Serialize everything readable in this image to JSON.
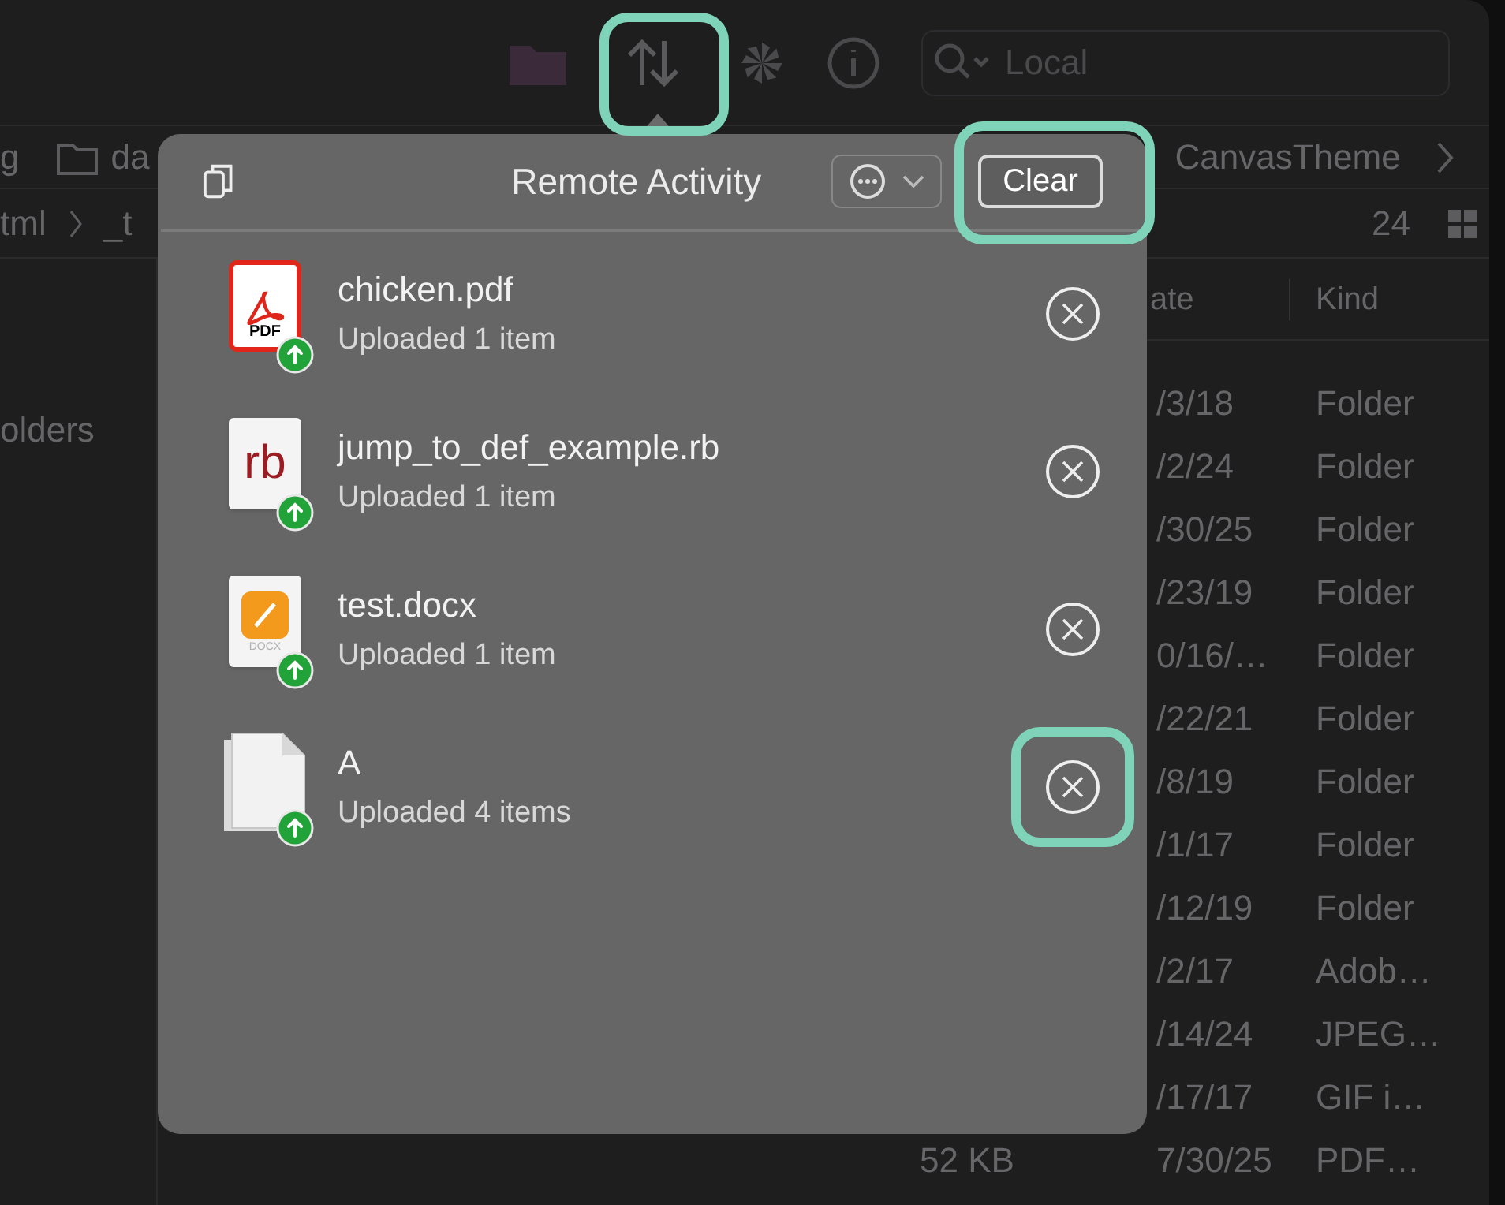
{
  "toolbar": {
    "search_placeholder": "Local",
    "transfer_highlighted": true
  },
  "path_bar": [
    {
      "label": "g",
      "kind": "text"
    },
    {
      "label": "da",
      "kind": "folder"
    },
    {
      "label": "CanvasTheme",
      "kind": "text"
    }
  ],
  "breadcrumbs": [
    "tml",
    "_t"
  ],
  "item_count": "24",
  "sidebar": {
    "items": [
      "olders"
    ]
  },
  "file_list": {
    "columns": [
      "ate",
      "Kind"
    ],
    "rows": [
      {
        "date": "/3/18",
        "type_label": "Folder"
      },
      {
        "date": "/2/24",
        "type_label": "Folder"
      },
      {
        "date": "/30/25",
        "type_label": "Folder"
      },
      {
        "date": "/23/19",
        "type_label": "Folder"
      },
      {
        "date": "0/16/…",
        "type_label": "Folder"
      },
      {
        "date": "/22/21",
        "type_label": "Folder"
      },
      {
        "date": "/8/19",
        "type_label": "Folder"
      },
      {
        "date": "/1/17",
        "type_label": "Folder"
      },
      {
        "date": "/12/19",
        "type_label": "Folder"
      },
      {
        "date": "/2/17",
        "type_label": "Adob…"
      },
      {
        "date": "/14/24",
        "type_label": "JPEG…"
      },
      {
        "date": "/17/17",
        "type_label": "GIF i…"
      },
      {
        "size": "52 KB",
        "date": "7/30/25",
        "type_label": "PDF…"
      }
    ]
  },
  "popover": {
    "title": "Remote Activity",
    "clear_label": "Clear",
    "clear_highlighted": true,
    "items": [
      {
        "name": "chicken.pdf",
        "status": "Uploaded 1 item",
        "kind": "pdf",
        "badge": "PDF",
        "remove_highlighted": false
      },
      {
        "name": "jump_to_def_example.rb",
        "status": "Uploaded 1 item",
        "kind": "rb",
        "badge": "rb",
        "remove_highlighted": false
      },
      {
        "name": "test.docx",
        "status": "Uploaded 1 item",
        "kind": "docx",
        "badge": "DOCX",
        "remove_highlighted": false
      },
      {
        "name": "A",
        "status": "Uploaded 4 items",
        "kind": "folder",
        "remove_highlighted": true
      }
    ]
  }
}
